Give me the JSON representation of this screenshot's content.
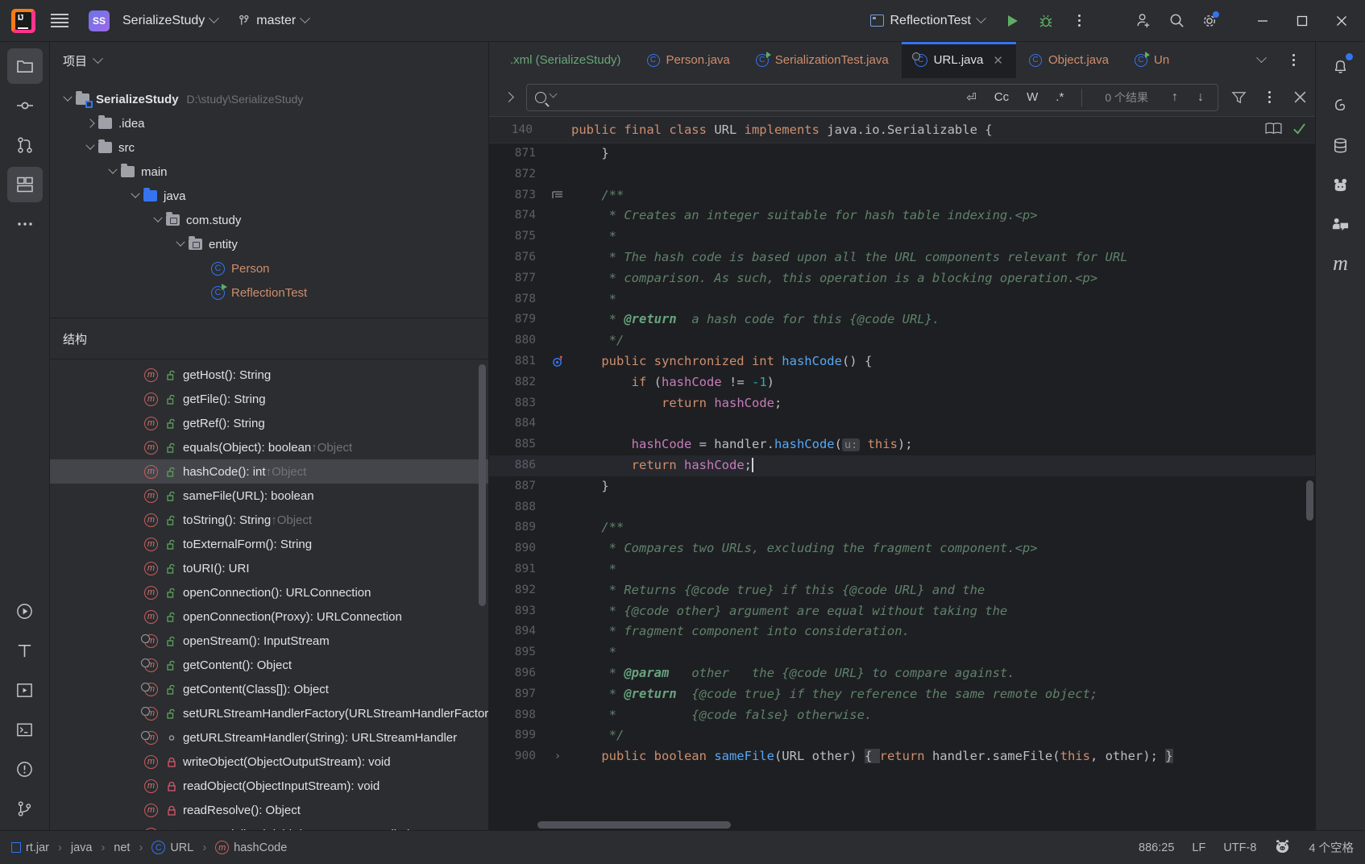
{
  "titlebar": {
    "project_name": "SerializeStudy",
    "branch": "master",
    "run_config": "ReflectionTest",
    "icons": {
      "logo": "intellij-logo",
      "menu": "hamburger-menu-icon",
      "vcs": "branch-icon",
      "run": "run-icon",
      "debug": "debug-icon",
      "more": "more-vertical-icon",
      "account": "add-account-icon",
      "search": "search-everywhere-icon",
      "settings": "settings-gear-icon",
      "minimize": "minimize-icon",
      "maximize": "maximize-icon",
      "close": "close-icon"
    }
  },
  "left_rail": {
    "items": [
      {
        "name": "project-tool-window",
        "icon": "folder-icon",
        "active": true
      },
      {
        "name": "commit-tool-window",
        "icon": "commit-icon",
        "active": false
      },
      {
        "name": "pull-requests-tool-window",
        "icon": "pull-request-icon",
        "active": false
      },
      {
        "name": "structure-tool-window",
        "icon": "structure-icon",
        "active": true
      },
      {
        "name": "more-tool-windows",
        "icon": "more-horizontal-icon",
        "active": false
      }
    ],
    "bottom_items": [
      {
        "name": "run-tool-window",
        "icon": "run-icon"
      },
      {
        "name": "terminal-tool-window",
        "icon": "terminal-t-icon"
      },
      {
        "name": "services-tool-window",
        "icon": "services-play-icon"
      },
      {
        "name": "terminal2-tool-window",
        "icon": "terminal-window-icon"
      },
      {
        "name": "problems-tool-window",
        "icon": "warning-circle-icon"
      },
      {
        "name": "version-control-tool-window",
        "icon": "git-branch-icon"
      }
    ]
  },
  "right_rail": {
    "items": [
      {
        "name": "notifications",
        "icon": "bell-icon",
        "badge": true
      },
      {
        "name": "ai-assistant",
        "icon": "spiral-icon",
        "badge": false
      },
      {
        "name": "database",
        "icon": "database-icon",
        "badge": false
      },
      {
        "name": "bigdata-tools",
        "icon": "pandas-icon",
        "badge": false
      },
      {
        "name": "code-with-me",
        "icon": "code-with-me-icon",
        "badge": false
      },
      {
        "name": "maven",
        "icon": "maven-m-icon",
        "badge": false
      }
    ]
  },
  "project_panel": {
    "title": "项目",
    "tree": [
      {
        "indent": 0,
        "arrow": "down",
        "icon": "module-folder",
        "label": "SerializeStudy",
        "bold": true,
        "path": "D:\\study\\SerializeStudy"
      },
      {
        "indent": 1,
        "arrow": "right",
        "icon": "folder",
        "label": ".idea",
        "bold": false,
        "path": ""
      },
      {
        "indent": 1,
        "arrow": "down",
        "icon": "folder",
        "label": "src",
        "bold": false,
        "path": ""
      },
      {
        "indent": 2,
        "arrow": "down",
        "icon": "folder",
        "label": "main",
        "bold": false,
        "path": ""
      },
      {
        "indent": 3,
        "arrow": "down",
        "icon": "source-folder",
        "label": "java",
        "bold": false,
        "path": ""
      },
      {
        "indent": 4,
        "arrow": "down",
        "icon": "package",
        "label": "com.study",
        "bold": false,
        "path": ""
      },
      {
        "indent": 5,
        "arrow": "down",
        "icon": "package",
        "label": "entity",
        "bold": false,
        "path": ""
      },
      {
        "indent": 6,
        "arrow": "none",
        "icon": "class",
        "label": "Person",
        "bold": false,
        "path": ""
      },
      {
        "indent": 6,
        "arrow": "none",
        "icon": "runnable-class",
        "label": "ReflectionTest",
        "bold": false,
        "path": ""
      }
    ]
  },
  "structure_panel": {
    "title": "结构",
    "items": [
      {
        "vis": "public",
        "label": "getHost(): String",
        "sup": "",
        "static": false,
        "selected": false
      },
      {
        "vis": "public",
        "label": "getFile(): String",
        "sup": "",
        "static": false,
        "selected": false
      },
      {
        "vis": "public",
        "label": "getRef(): String",
        "sup": "",
        "static": false,
        "selected": false
      },
      {
        "vis": "public",
        "label": "equals(Object): boolean",
        "sup": "↑Object",
        "static": false,
        "selected": false
      },
      {
        "vis": "public",
        "label": "hashCode(): int",
        "sup": "↑Object",
        "static": false,
        "selected": true
      },
      {
        "vis": "public",
        "label": "sameFile(URL): boolean",
        "sup": "",
        "static": false,
        "selected": false
      },
      {
        "vis": "public",
        "label": "toString(): String",
        "sup": "↑Object",
        "static": false,
        "selected": false
      },
      {
        "vis": "public",
        "label": "toExternalForm(): String",
        "sup": "",
        "static": false,
        "selected": false
      },
      {
        "vis": "public",
        "label": "toURI(): URI",
        "sup": "",
        "static": false,
        "selected": false
      },
      {
        "vis": "public",
        "label": "openConnection(): URLConnection",
        "sup": "",
        "static": false,
        "selected": false
      },
      {
        "vis": "public",
        "label": "openConnection(Proxy): URLConnection",
        "sup": "",
        "static": false,
        "selected": false
      },
      {
        "vis": "public",
        "label": "openStream(): InputStream",
        "sup": "",
        "static": true,
        "selected": false
      },
      {
        "vis": "public",
        "label": "getContent(): Object",
        "sup": "",
        "static": true,
        "selected": false
      },
      {
        "vis": "public",
        "label": "getContent(Class[]): Object",
        "sup": "",
        "static": true,
        "selected": false
      },
      {
        "vis": "public",
        "label": "setURLStreamHandlerFactory(URLStreamHandlerFactory): void",
        "sup": "",
        "static": true,
        "selected": false
      },
      {
        "vis": "package",
        "label": "getURLStreamHandler(String): URLStreamHandler",
        "sup": "",
        "static": true,
        "selected": false
      },
      {
        "vis": "private",
        "label": "writeObject(ObjectOutputStream): void",
        "sup": "",
        "static": false,
        "selected": false
      },
      {
        "vis": "private",
        "label": "readObject(ObjectInputStream): void",
        "sup": "",
        "static": false,
        "selected": false
      },
      {
        "vis": "private",
        "label": "readResolve(): Object",
        "sup": "",
        "static": false,
        "selected": false
      },
      {
        "vis": "private",
        "label": "setDeserializedFields(URLStreamHandler): URL",
        "sup": "",
        "static": false,
        "selected": false
      }
    ]
  },
  "editor": {
    "tabs": [
      {
        "label": ".xml (SerializeStudy)",
        "icon": "xml-file-icon",
        "active": false,
        "closable": false
      },
      {
        "label": "Person.java",
        "icon": "class-icon",
        "active": false,
        "closable": false
      },
      {
        "label": "SerializationTest.java",
        "icon": "runnable-class-icon",
        "active": false,
        "closable": false
      },
      {
        "label": "URL.java",
        "icon": "library-class-icon",
        "active": true,
        "closable": true
      },
      {
        "label": "Object.java",
        "icon": "class-icon",
        "active": false,
        "closable": false
      },
      {
        "label": "Un",
        "icon": "runnable-class-icon",
        "active": false,
        "closable": false
      }
    ],
    "tab_overflow_icon": "chevron-down-icon",
    "tab_options_icon": "more-vertical-icon",
    "findbar": {
      "placeholder": "",
      "value": "",
      "result_count": "0 个结果",
      "toggles": [
        {
          "name": "regex-newline-toggle",
          "glyph": "⏎"
        },
        {
          "name": "match-case-toggle",
          "glyph": "Cc"
        },
        {
          "name": "words-toggle",
          "glyph": "W"
        },
        {
          "name": "regex-toggle",
          "glyph": ".*"
        }
      ],
      "prev_icon": "arrow-up-icon",
      "next_icon": "arrow-down-icon",
      "filter_icon": "filter-icon",
      "more_icon": "more-vertical-icon",
      "close_icon": "close-icon"
    },
    "sticky_line": {
      "number": "140",
      "text": "public final class URL implements java.io.Serializable {"
    },
    "reader_mode_icon": "reader-mode-icon",
    "inspection_ok_icon": "inspection-ok-check",
    "lines": [
      {
        "n": "871",
        "indent": 1,
        "gicon": "",
        "tokens": [
          {
            "t": "    }",
            "c": "type"
          }
        ]
      },
      {
        "n": "872",
        "indent": 0,
        "gicon": "",
        "tokens": []
      },
      {
        "n": "873",
        "indent": 0,
        "gicon": "doc-fold",
        "tokens": [
          {
            "t": "    /**",
            "c": "cmt"
          }
        ]
      },
      {
        "n": "874",
        "indent": 0,
        "gicon": "",
        "tokens": [
          {
            "t": "     * Creates an integer suitable for hash table indexing.<p>",
            "c": "cmt"
          }
        ]
      },
      {
        "n": "875",
        "indent": 0,
        "gicon": "",
        "tokens": [
          {
            "t": "     *",
            "c": "cmt"
          }
        ]
      },
      {
        "n": "876",
        "indent": 0,
        "gicon": "",
        "tokens": [
          {
            "t": "     * The hash code is based upon all the URL components relevant for URL",
            "c": "cmt"
          }
        ]
      },
      {
        "n": "877",
        "indent": 0,
        "gicon": "",
        "tokens": [
          {
            "t": "     * comparison. As such, this operation is a blocking operation.<p>",
            "c": "cmt"
          }
        ]
      },
      {
        "n": "878",
        "indent": 0,
        "gicon": "",
        "tokens": [
          {
            "t": "     *",
            "c": "cmt"
          }
        ]
      },
      {
        "n": "879",
        "indent": 0,
        "gicon": "",
        "tokens": [
          {
            "t": "     * ",
            "c": "cmt"
          },
          {
            "t": "@return",
            "c": "tag"
          },
          {
            "t": "  a hash code for this {@code URL}.",
            "c": "cmt"
          }
        ]
      },
      {
        "n": "880",
        "indent": 0,
        "gicon": "",
        "tokens": [
          {
            "t": "     */",
            "c": "cmt"
          }
        ]
      },
      {
        "n": "881",
        "indent": 0,
        "gicon": "override",
        "tokens": [
          {
            "t": "    ",
            "c": "type"
          },
          {
            "t": "public synchronized int ",
            "c": "kw"
          },
          {
            "t": "hashCode",
            "c": "fn"
          },
          {
            "t": "() {",
            "c": "type"
          }
        ]
      },
      {
        "n": "882",
        "indent": 0,
        "gicon": "",
        "tokens": [
          {
            "t": "        ",
            "c": "type"
          },
          {
            "t": "if",
            "c": "kw"
          },
          {
            "t": " (",
            "c": "type"
          },
          {
            "t": "hashCode",
            "c": "fld"
          },
          {
            "t": " != ",
            "c": "type"
          },
          {
            "t": "-1",
            "c": "num"
          },
          {
            "t": ")",
            "c": "type"
          }
        ]
      },
      {
        "n": "883",
        "indent": 0,
        "gicon": "",
        "tokens": [
          {
            "t": "            ",
            "c": "type"
          },
          {
            "t": "return",
            "c": "kw"
          },
          {
            "t": " ",
            "c": "type"
          },
          {
            "t": "hashCode",
            "c": "fld"
          },
          {
            "t": ";",
            "c": "type"
          }
        ]
      },
      {
        "n": "884",
        "indent": 0,
        "gicon": "",
        "tokens": []
      },
      {
        "n": "885",
        "indent": 0,
        "gicon": "",
        "tokens": [
          {
            "t": "        ",
            "c": "type"
          },
          {
            "t": "hashCode",
            "c": "fld"
          },
          {
            "t": " = handler.",
            "c": "type"
          },
          {
            "t": "hashCode",
            "c": "fn"
          },
          {
            "t": "(",
            "c": "type"
          },
          {
            "t": "u:",
            "c": "hint"
          },
          {
            "t": " ",
            "c": "type"
          },
          {
            "t": "this",
            "c": "kw"
          },
          {
            "t": ");",
            "c": "type"
          }
        ]
      },
      {
        "n": "886",
        "indent": 0,
        "gicon": "",
        "current": true,
        "tokens": [
          {
            "t": "        ",
            "c": "type"
          },
          {
            "t": "return",
            "c": "kw"
          },
          {
            "t": " ",
            "c": "type"
          },
          {
            "t": "hashCode",
            "c": "fld"
          },
          {
            "t": ";",
            "c": "type"
          }
        ]
      },
      {
        "n": "887",
        "indent": 0,
        "gicon": "",
        "tokens": [
          {
            "t": "    }",
            "c": "type"
          }
        ]
      },
      {
        "n": "888",
        "indent": 0,
        "gicon": "",
        "tokens": []
      },
      {
        "n": "889",
        "indent": 0,
        "gicon": "",
        "tokens": [
          {
            "t": "    /**",
            "c": "cmt"
          }
        ]
      },
      {
        "n": "890",
        "indent": 0,
        "gicon": "",
        "tokens": [
          {
            "t": "     * Compares two URLs, excluding the fragment component.<p>",
            "c": "cmt"
          }
        ]
      },
      {
        "n": "891",
        "indent": 0,
        "gicon": "",
        "tokens": [
          {
            "t": "     *",
            "c": "cmt"
          }
        ]
      },
      {
        "n": "892",
        "indent": 0,
        "gicon": "",
        "tokens": [
          {
            "t": "     * Returns {@code true} if this {@code URL} and the",
            "c": "cmt"
          }
        ]
      },
      {
        "n": "893",
        "indent": 0,
        "gicon": "",
        "tokens": [
          {
            "t": "     * {@code other} argument are equal without taking the",
            "c": "cmt"
          }
        ]
      },
      {
        "n": "894",
        "indent": 0,
        "gicon": "",
        "tokens": [
          {
            "t": "     * fragment component into consideration.",
            "c": "cmt"
          }
        ]
      },
      {
        "n": "895",
        "indent": 0,
        "gicon": "",
        "tokens": [
          {
            "t": "     *",
            "c": "cmt"
          }
        ]
      },
      {
        "n": "896",
        "indent": 0,
        "gicon": "",
        "tokens": [
          {
            "t": "     * ",
            "c": "cmt"
          },
          {
            "t": "@param",
            "c": "tag"
          },
          {
            "t": "   other   the {@code URL} to compare against.",
            "c": "cmt"
          }
        ]
      },
      {
        "n": "897",
        "indent": 0,
        "gicon": "",
        "tokens": [
          {
            "t": "     * ",
            "c": "cmt"
          },
          {
            "t": "@return",
            "c": "tag"
          },
          {
            "t": "  {@code true} if they reference the same remote object;",
            "c": "cmt"
          }
        ]
      },
      {
        "n": "898",
        "indent": 0,
        "gicon": "",
        "tokens": [
          {
            "t": "     *          {@code false} otherwise.",
            "c": "cmt"
          }
        ]
      },
      {
        "n": "899",
        "indent": 0,
        "gicon": "",
        "tokens": [
          {
            "t": "     */",
            "c": "cmt"
          }
        ]
      },
      {
        "n": "900",
        "indent": 0,
        "gicon": "expand",
        "tokens": [
          {
            "t": "    ",
            "c": "type"
          },
          {
            "t": "public boolean ",
            "c": "kw"
          },
          {
            "t": "sameFile",
            "c": "fn"
          },
          {
            "t": "(URL other) ",
            "c": "type"
          },
          {
            "t": "{ ",
            "c": "fold"
          },
          {
            "t": "return",
            "c": "kw"
          },
          {
            "t": " handler.sameFile(",
            "c": "type"
          },
          {
            "t": "this",
            "c": "kw"
          },
          {
            "t": ", other); ",
            "c": "type"
          },
          {
            "t": "}",
            "c": "fold"
          }
        ]
      }
    ]
  },
  "statusbar": {
    "breadcrumb": [
      {
        "label": "rt.jar",
        "icon": "jar-icon"
      },
      {
        "label": "java",
        "icon": ""
      },
      {
        "label": "net",
        "icon": ""
      },
      {
        "label": "URL",
        "icon": "class-icon"
      },
      {
        "label": "hashCode",
        "icon": "method-icon"
      }
    ],
    "caret": "886:25",
    "line_separator": "LF",
    "encoding": "UTF-8",
    "indent": "4 个空格",
    "ide_icon": "pig-face-icon"
  }
}
